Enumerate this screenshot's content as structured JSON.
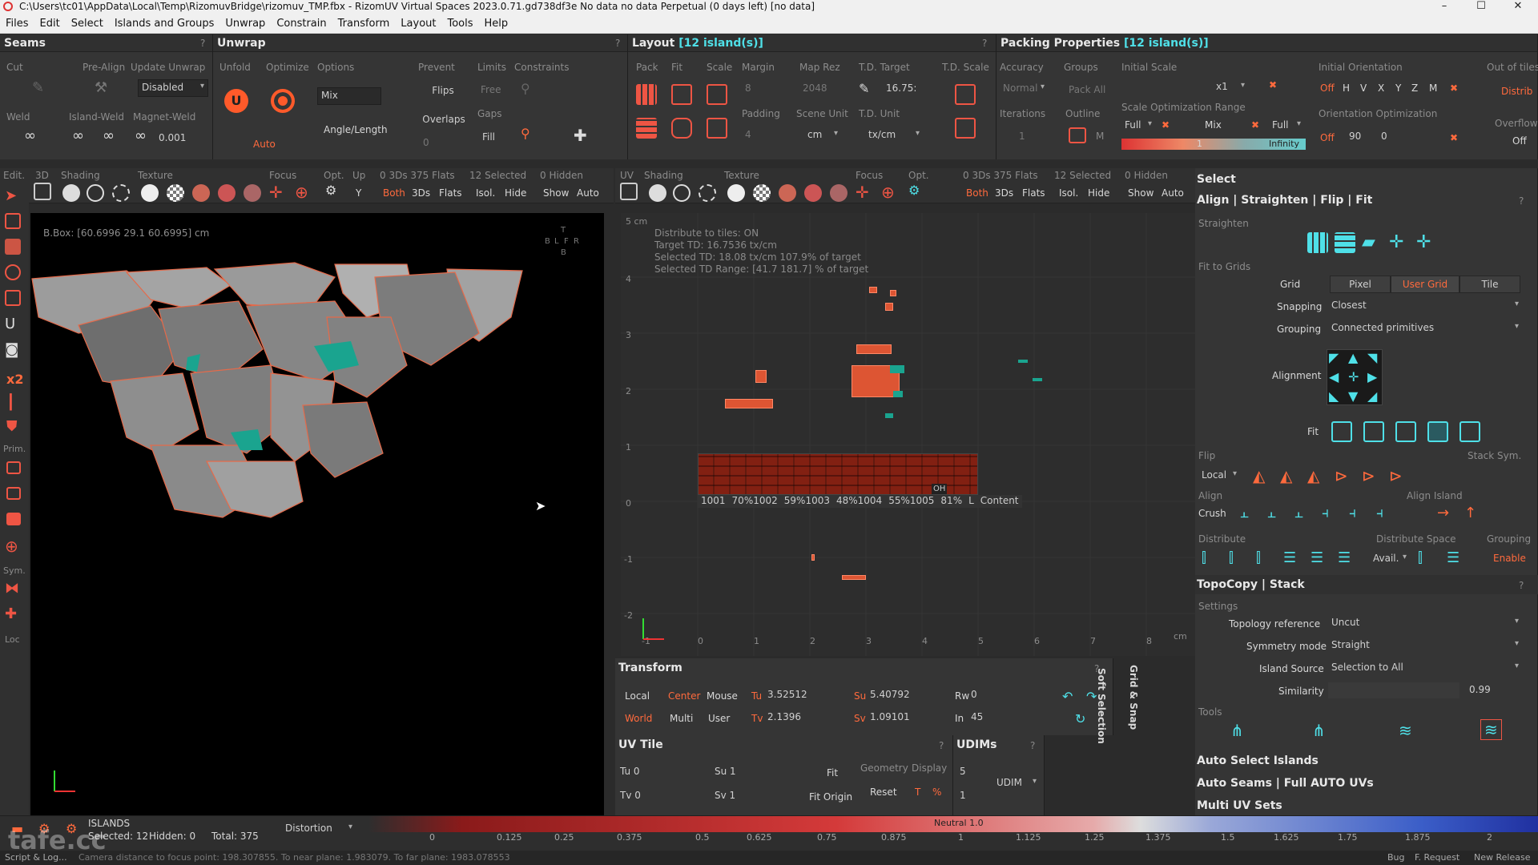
{
  "window": {
    "title": "C:\\Users\\tc01\\AppData\\Local\\Temp\\RizomuvBridge\\rizomuv_TMP.fbx - RizomUV  Virtual Spaces 2023.0.71.gd738df3e No data no data Perpetual  (0 days left) [no data]",
    "minimize": "–",
    "maximize": "☐",
    "close": "✕"
  },
  "menu": [
    "Files",
    "Edit",
    "Select",
    "Islands and Groups",
    "Unwrap",
    "Constrain",
    "Transform",
    "Layout",
    "Tools",
    "Help"
  ],
  "seams": {
    "title": "Seams",
    "help": "?",
    "cut": "Cut",
    "pre_align": "Pre-Align",
    "weld": "Weld",
    "island_weld": "Island-Weld",
    "magnet_weld": "Magnet-Weld",
    "update_unwrap": "Update Unwrap",
    "update_unwrap_value": "Disabled",
    "magnet_value": "0.001"
  },
  "unwrap": {
    "title": "Unwrap",
    "help": "?",
    "unfold": "Unfold",
    "optimize": "Optimize",
    "options": "Options",
    "options_value": "Mix",
    "angle_length": "Angle/Length",
    "auto": "Auto",
    "prevent": "Prevent",
    "flips": "Flips",
    "overlaps": "Overlaps",
    "overlaps_value": "0",
    "limits": "Limits",
    "limits_value": "Free",
    "gaps": "Gaps",
    "fill": "Fill",
    "constraints": "Constraints"
  },
  "layout": {
    "title": "Layout ",
    "title_count": "[12 island(s)]",
    "help": "?",
    "pack": "Pack",
    "fit": "Fit",
    "scale": "Scale",
    "margin": "Margin",
    "margin_value": "8",
    "padding": "Padding",
    "padding_value": "4",
    "map_rez": "Map Rez",
    "map_rez_value": "2048",
    "scene_unit": "Scene Unit",
    "scene_unit_value": "cm",
    "td_target": "T.D. Target",
    "td_target_value": "16.75:",
    "td_unit": "T.D. Unit",
    "td_unit_value": "tx/cm",
    "td_scale": "T.D. Scale"
  },
  "packing": {
    "title": "Packing Properties ",
    "title_count": "[12 island(s)]",
    "accuracy": "Accuracy",
    "accuracy_value": "Normal",
    "groups": "Groups",
    "pack_all": "Pack All",
    "iterations": "Iterations",
    "iterations_value": "1",
    "outline": "Outline",
    "outline_m": "M",
    "initial_scale": "Initial Scale",
    "initial_scale_value": "x1",
    "scale_opt_range": "Scale Optimization Range",
    "full": "Full",
    "mix": "Mix",
    "full2": "Full",
    "range_value": "1",
    "infinity": "Infinity",
    "initial_orientation": "Initial Orientation",
    "orient_off": "Off",
    "orient_buttons": [
      "H",
      "V",
      "X",
      "Y",
      "Z",
      "M"
    ],
    "orientation_opt": "Orientation Optimization",
    "orient_opt_off": "Off",
    "orient_step": "90",
    "orient_value": "0",
    "out_of_tiles": "Out of tiles",
    "distrib": "Distrib",
    "overflow": "Overflow",
    "overflow_value": "Off"
  },
  "toolbar3d": {
    "edit": "Edit.",
    "3d": "3D",
    "shading": "Shading",
    "texture": "Texture",
    "focus": "Focus",
    "opt": "Opt.",
    "up": "Up",
    "up_value": "Y",
    "counts": "0 3Ds 375 Flats",
    "selected": "12 Selected",
    "hidden": "0 Hidden",
    "both": "Both",
    "3ds": "3Ds",
    "flats": "Flats",
    "isol": "Isol.",
    "hide": "Hide",
    "show": "Show",
    "auto": "Auto"
  },
  "toolbaruv": {
    "uv": "UV",
    "shading": "Shading",
    "texture": "Texture",
    "focus": "Focus",
    "opt": "Opt.",
    "counts": "0 3Ds 375 Flats",
    "selected": "12 Selected",
    "hidden": "0 Hidden",
    "both": "Both",
    "3ds": "3Ds",
    "flats": "Flats",
    "isol": "Isol.",
    "hide": "Hide",
    "show": "Show",
    "auto": "Auto"
  },
  "leftbar": {
    "prim": "Prim.",
    "sym": "Sym.",
    "loc": "Loc",
    "x2": "x2"
  },
  "viewport3d": {
    "bbox": "B.Box: [60.6996 29.1 60.6995] cm",
    "cube": [
      "T",
      "B",
      "L",
      "F",
      "R",
      "B"
    ]
  },
  "uvview": {
    "scale_label": "5 cm",
    "info": [
      "Distribute to tiles: ON",
      "Target TD: 16.7536 tx/cm",
      "Selected TD: 18.08 tx/cm 107.9% of target",
      "Selected TD Range: [41.7  181.7] % of target"
    ],
    "y_ticks": [
      "4",
      "3",
      "2",
      "1",
      "0",
      "-1",
      "-2"
    ],
    "x_ticks": [
      "-1",
      "0",
      "1",
      "2",
      "3",
      "4",
      "5",
      "6",
      "7",
      "8"
    ],
    "unit": "cm",
    "tile_labels": [
      "1001",
      "70%1002",
      "59%1003",
      "48%1004",
      "55%1005",
      "81%",
      "L",
      "Content"
    ],
    "oh": "OH"
  },
  "transform": {
    "title": "Transform",
    "help": "?",
    "local": "Local",
    "center": "Center",
    "mouse": "Mouse",
    "world": "World",
    "multi": "Multi",
    "user": "User",
    "tu_label": "Tu",
    "tu": "3.52512",
    "tv_label": "Tv",
    "tv": "2.1396",
    "su_label": "Su",
    "su": "5.40792",
    "sv_label": "Sv",
    "sv": "1.09101",
    "rw_label": "Rw",
    "rw": "0",
    "in_label": "In",
    "in": "45",
    "soft_selection": "Soft Selection",
    "grid_snap": "Grid & Snap"
  },
  "uvtile": {
    "title": "UV Tile",
    "help": "?",
    "tu": "Tu 0",
    "tv": "Tv 0",
    "su": "Su 1",
    "sv": "Sv 1",
    "fit": "Fit",
    "fit_origin": "Fit Origin",
    "geometry": "Geometry",
    "display": "Display",
    "reset": "Reset",
    "t": "T",
    "pct": "%"
  },
  "udims": {
    "title": "UDIMs",
    "help": "?",
    "v1": "5",
    "v2": "1",
    "udim": "UDIM"
  },
  "select": {
    "title": "Select",
    "section": "Align | Straighten | Flip | Fit",
    "help": "?",
    "straighten": "Straighten",
    "fit_to_grids": "Fit to Grids",
    "grid": "Grid",
    "pixel": "Pixel",
    "user_grid": "User Grid",
    "tile": "Tile",
    "snapping": "Snapping",
    "snapping_value": "Closest",
    "grouping": "Grouping",
    "grouping_value": "Connected primitives",
    "alignment": "Alignment",
    "fit": "Fit",
    "flip": "Flip",
    "flip_local": "Local",
    "stack_sym": "Stack Sym.",
    "align": "Align",
    "crush": "Crush",
    "align_island": "Align Island",
    "distribute": "Distribute",
    "distribute_space": "Distribute Space",
    "avail": "Avail.",
    "grouping2": "Grouping",
    "enable": "Enable"
  },
  "topocopy": {
    "title": "TopoCopy | Stack",
    "help": "?",
    "settings": "Settings",
    "topology_reference": "Topology reference",
    "topology_reference_value": "Uncut",
    "symmetry_mode": "Symmetry mode",
    "symmetry_mode_value": "Straight",
    "island_source": "Island Source",
    "island_source_value": "Selection to All",
    "similarity": "Similarity",
    "similarity_value": "0.99",
    "tools": "Tools"
  },
  "links": {
    "auto_select": "Auto Select Islands",
    "auto_seams": "Auto Seams | Full AUTO UVs",
    "multi_uv": "Multi UV Sets"
  },
  "status": {
    "islands": "ISLANDS",
    "selected": "Selected: 12",
    "hidden": "Hidden: 0",
    "total": "Total: 375",
    "distortion": "Distortion",
    "neutral": "Neutral 1.0",
    "scale_ticks": [
      "0",
      "0.125",
      "0.25",
      "0.375",
      "0.5",
      "0.625",
      "0.75",
      "0.875",
      "1",
      "1.125",
      "1.25",
      "1.375",
      "1.5",
      "1.625",
      "1.75",
      "1.875",
      "2"
    ],
    "script": "Script & Log...",
    "camera": "Camera distance to focus point: 198.307855. To near plane: 1.983079. To far plane: 1983.078553",
    "bug": "Bug",
    "f_request": "F. Request",
    "new_release": "New Release",
    "watermark": "tafe.cc"
  },
  "colors": {
    "accent": "#ff6a3d",
    "cyan": "#4fe0e8",
    "panel": "#353535",
    "viewport": "#000000"
  }
}
